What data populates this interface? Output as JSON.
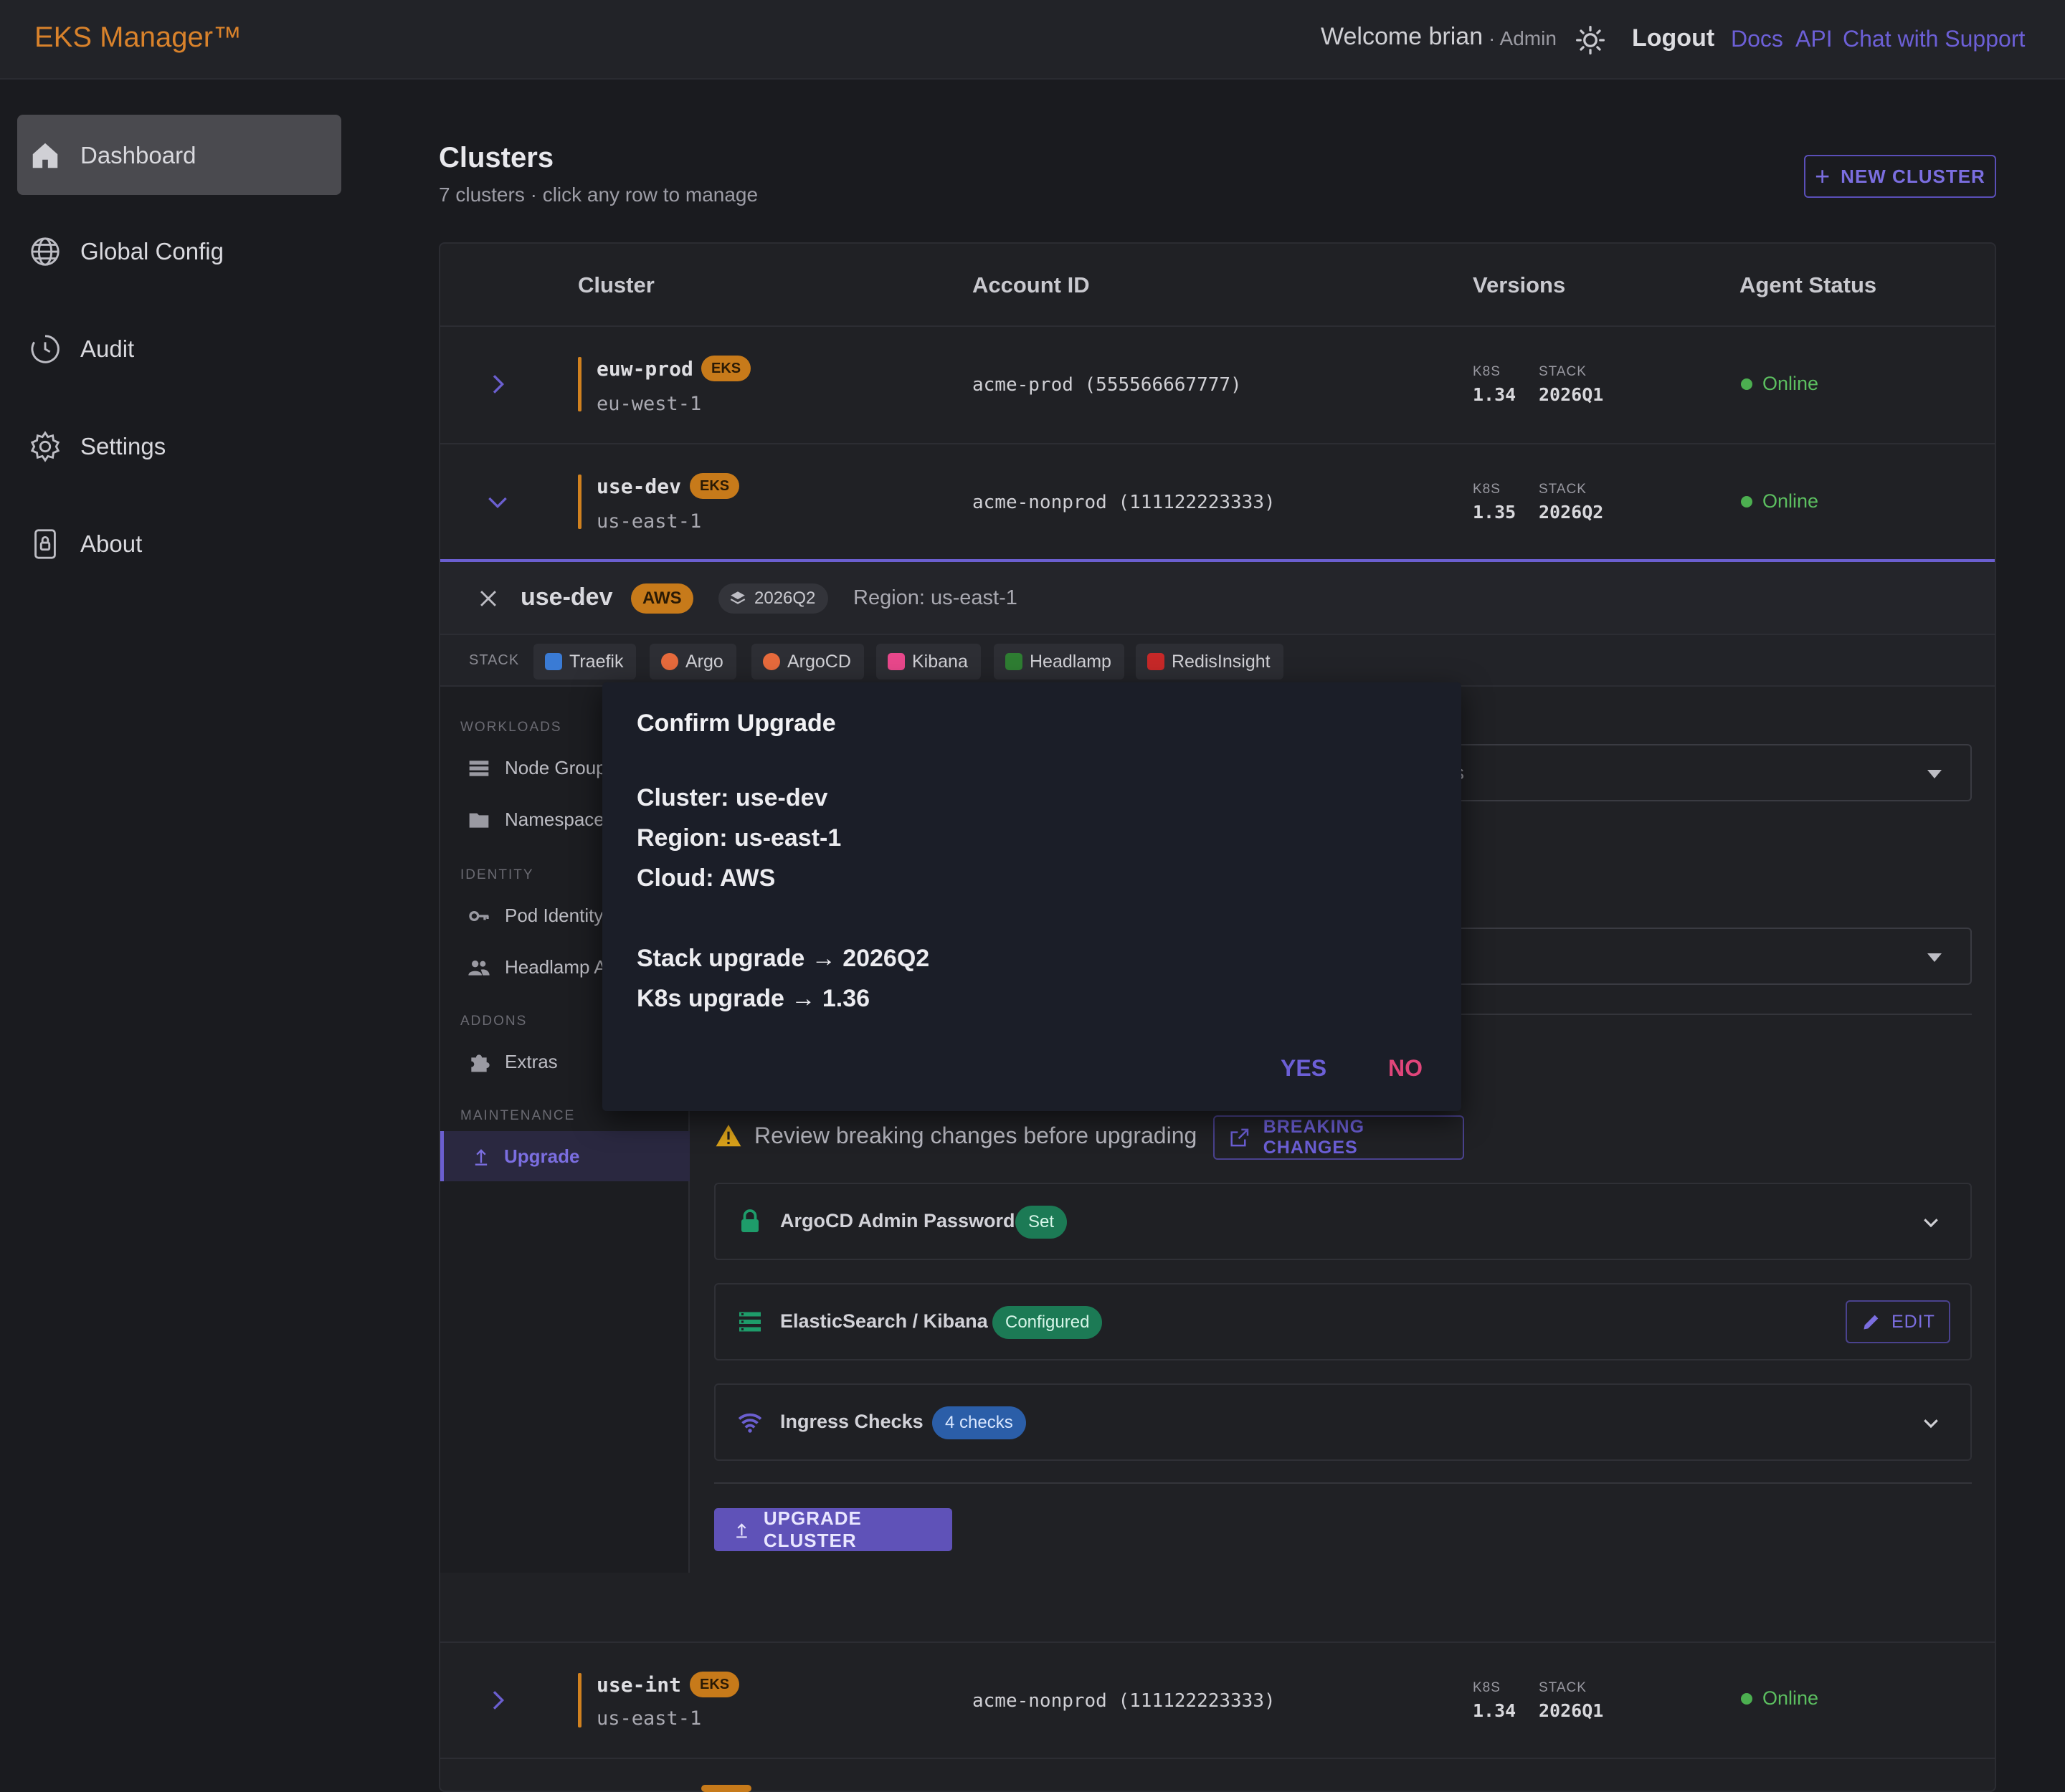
{
  "app": {
    "brand": "EKS Manager™",
    "welcome": "Welcome brian",
    "role": "· Admin",
    "logout": "Logout",
    "links": [
      "Docs",
      "API",
      "Chat with Support"
    ]
  },
  "sidebar": {
    "items": [
      {
        "label": "Dashboard",
        "icon": "home-icon",
        "active": true
      },
      {
        "label": "Global Config",
        "icon": "globe-icon"
      },
      {
        "label": "Audit",
        "icon": "clock-icon"
      },
      {
        "label": "Settings",
        "icon": "gear-icon"
      },
      {
        "label": "About",
        "icon": "lock-icon"
      }
    ]
  },
  "clusters": {
    "title": "Clusters",
    "subtitle": "7 clusters · click any row to manage",
    "new_button": "NEW CLUSTER",
    "columns": [
      "Cluster",
      "Account ID",
      "Versions",
      "Agent Status"
    ],
    "version_labels": {
      "k8s": "K8S",
      "stack": "STACK"
    },
    "rows": [
      {
        "name": "euw-prod",
        "badge": "EKS",
        "region": "eu-west-1",
        "account": "acme-prod (555566667777)",
        "k8s": "1.34",
        "stack": "2026Q1",
        "status": "Online"
      },
      {
        "name": "use-dev",
        "badge": "EKS",
        "region": "us-east-1",
        "account": "acme-nonprod (111122223333)",
        "k8s": "1.35",
        "stack": "2026Q2",
        "status": "Online"
      },
      {
        "name": "use-int",
        "badge": "EKS",
        "region": "us-east-1",
        "account": "acme-nonprod (111122223333)",
        "k8s": "1.34",
        "stack": "2026Q1",
        "status": "Online"
      }
    ]
  },
  "detail": {
    "name": "use-dev",
    "cloud_badge": "AWS",
    "stack_badge": "2026Q2",
    "region": "Region: us-east-1",
    "stack_label": "STACK",
    "stack_chips": [
      {
        "label": "Traefik",
        "color": "#3a7bd5"
      },
      {
        "label": "Argo",
        "color": "#e66a3c"
      },
      {
        "label": "ArgoCD",
        "color": "#e66a3c"
      },
      {
        "label": "Kibana",
        "color": "#e8478b"
      },
      {
        "label": "Headlamp",
        "color": "#2e7d32"
      },
      {
        "label": "RedisInsight",
        "color": "#c62828"
      }
    ],
    "nav": {
      "workloads": "WORKLOADS",
      "node_groups": "Node Groups",
      "namespaces": "Namespaces",
      "identity": "IDENTITY",
      "pod_identity": "Pod Identity",
      "headlamp": "Headlamp Access",
      "addons": "ADDONS",
      "extras": "Extras",
      "maintenance": "MAINTENANCE",
      "upgrade": "Upgrade"
    },
    "select_fragment": "s",
    "warning": "Review breaking changes before upgrading",
    "breaking_button": "BREAKING CHANGES",
    "accordions": [
      {
        "title": "ArgoCD Admin Password",
        "pill": "Set"
      },
      {
        "title": "ElasticSearch / Kibana",
        "pill": "Configured",
        "action": "EDIT"
      },
      {
        "title": "Ingress Checks",
        "pill": "4 checks"
      }
    ],
    "upgrade_button": "UPGRADE CLUSTER"
  },
  "modal": {
    "title": "Confirm Upgrade",
    "cluster": "Cluster: use-dev",
    "region": "Region: us-east-1",
    "cloud": "Cloud: AWS",
    "stack_upgrade": "Stack upgrade → 2026Q2",
    "k8s_upgrade": "K8s upgrade → 1.36",
    "yes": "YES",
    "no": "NO"
  },
  "colors": {
    "accent": "#6b5fd0",
    "brand": "#d9822b",
    "online": "#4caf50",
    "danger": "#e0457a"
  }
}
